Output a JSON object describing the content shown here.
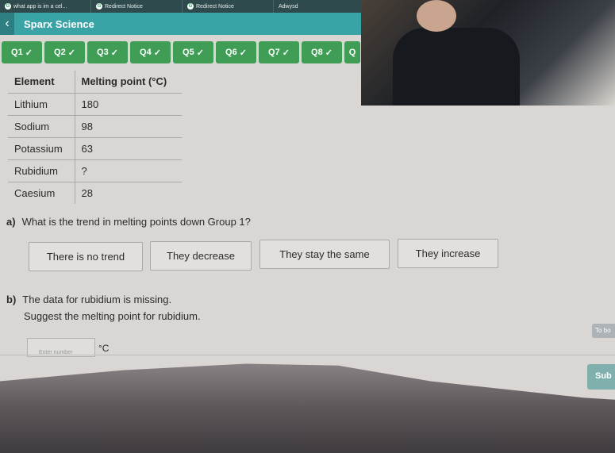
{
  "browser_tabs": [
    "what app is im a cel...",
    "Redirect Notice",
    "Redirect Notice",
    "Adwysd"
  ],
  "header": {
    "title": "Sparx Science",
    "back_icon": "chevron-left-icon"
  },
  "questions": [
    "Q1",
    "Q2",
    "Q3",
    "Q4",
    "Q5",
    "Q6",
    "Q7",
    "Q8",
    "Q"
  ],
  "check": "✓",
  "table": {
    "headers": [
      "Element",
      "Melting point (°C)"
    ],
    "rows": [
      [
        "Lithium",
        "180"
      ],
      [
        "Sodium",
        "98"
      ],
      [
        "Potassium",
        "63"
      ],
      [
        "Rubidium",
        "?"
      ],
      [
        "Caesium",
        "28"
      ]
    ]
  },
  "part_a": {
    "label": "a)",
    "text": "What is the trend in melting points down Group 1?",
    "options": [
      "There is no trend",
      "They decrease",
      "They stay the same",
      "They increase"
    ]
  },
  "part_b": {
    "label": "b)",
    "text": "The data for rubidium is missing.",
    "prompt": "Suggest the melting point for rubidium.",
    "placeholder": "Enter number",
    "unit": "°C"
  },
  "to_board": "To bo",
  "submit": "Sub",
  "colors": {
    "header": "#3aa3a6",
    "question_done": "#3f9d55",
    "submit": "#7fb0ae"
  }
}
